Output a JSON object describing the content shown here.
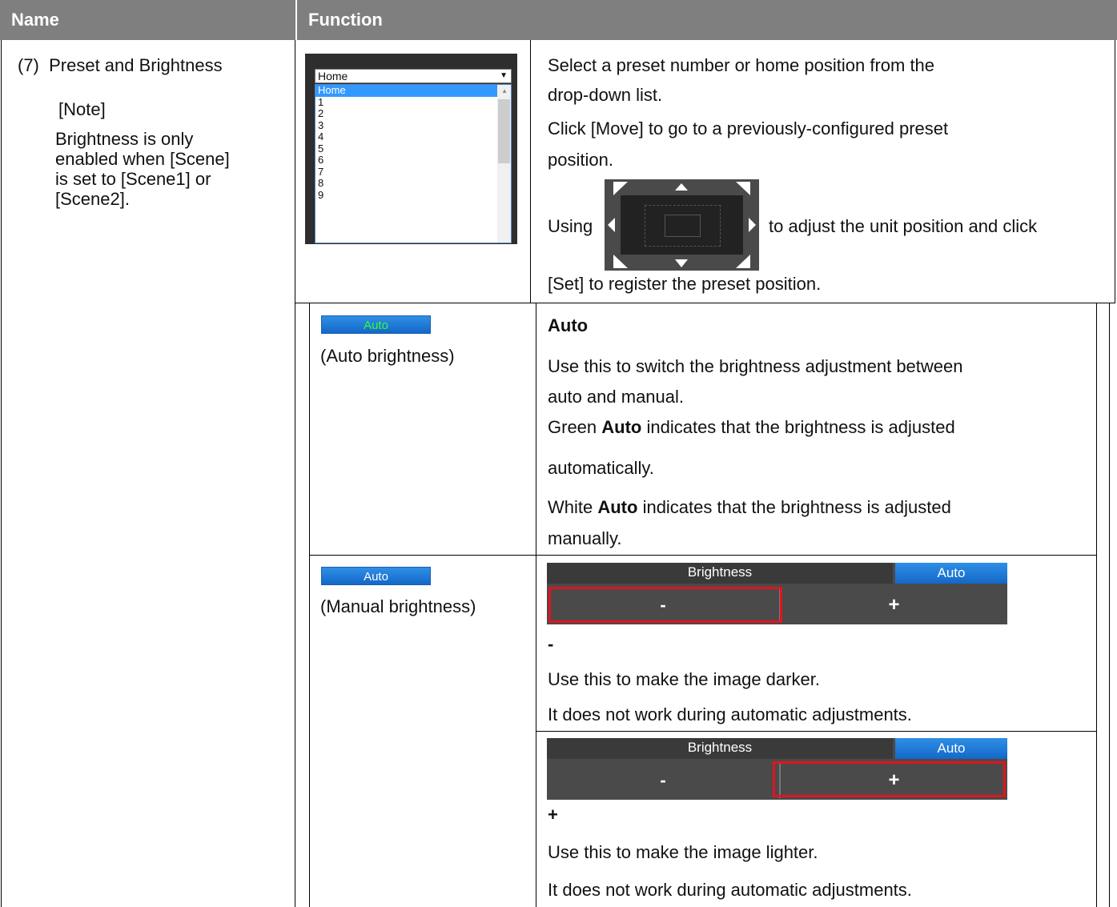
{
  "header": {
    "name": "Name",
    "function": "Function"
  },
  "name_cell": {
    "title": "(7)  Preset and Brightness",
    "note_label": "[Note]",
    "note_lines": [
      "Brightness is only",
      "enabled when [Scene]",
      "is set to [Scene1] or",
      "[Scene2]."
    ]
  },
  "dropdown": {
    "selected": "Home",
    "options": [
      "Home",
      "1",
      "2",
      "3",
      "4",
      "5",
      "6",
      "7",
      "8",
      "9"
    ]
  },
  "preset_desc": {
    "line1": "Select a preset number or home position from the",
    "line2": "drop-down list.",
    "line3": "Click [Move] to go to a previously-configured preset",
    "line4": "position.",
    "using": "Using",
    "using_after": "to adjust the unit position and click",
    "line6": "[Set] to register the preset position."
  },
  "auto_row": {
    "button_label": "Auto",
    "button_text_color": "#33ff33",
    "caption": "(Auto brightness)",
    "heading": "Auto",
    "desc1a": "Use this to switch the brightness adjustment between",
    "desc1b": "auto and manual.",
    "green_pre": "Green ",
    "green_bold": "Auto",
    "green_post": " indicates that the brightness is adjusted",
    "green_line2": "automatically.",
    "white_pre": "White ",
    "white_bold": "Auto",
    "white_post": " indicates that the brightness is adjusted",
    "white_line2": "manually."
  },
  "manual_row": {
    "button_label": "Auto",
    "button_text_color": "#ffffff",
    "caption": "(Manual brightness)",
    "widget": {
      "title": "Brightness",
      "auto": "Auto",
      "minus": "-",
      "plus": "+"
    },
    "minus_heading": "-",
    "minus_desc1": "Use this to make the image darker.",
    "minus_desc2": "It does not work during automatic adjustments.",
    "plus_heading": "+",
    "plus_desc1": "Use this to make the image lighter.",
    "plus_desc2": "It does not work during automatic adjustments."
  },
  "colors": {
    "header_bg": "#7f7f7f",
    "highlight": "#e0141e",
    "auto_blue": "#1f7ddb"
  }
}
